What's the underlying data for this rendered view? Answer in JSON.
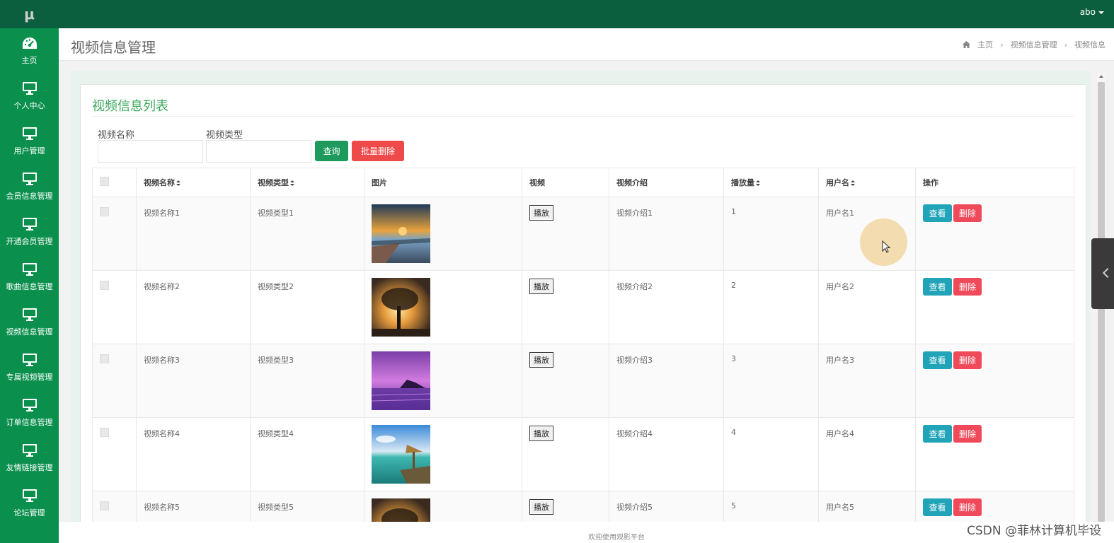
{
  "brand": {
    "logo_text": "μ"
  },
  "topbar": {
    "username": "abo"
  },
  "sidebar": {
    "items": [
      {
        "label": "主页",
        "icon": "dashboard-icon"
      },
      {
        "label": "个人中心",
        "icon": "monitor-icon"
      },
      {
        "label": "用户管理",
        "icon": "monitor-icon"
      },
      {
        "label": "会员信息管理",
        "icon": "monitor-icon"
      },
      {
        "label": "开通会员管理",
        "icon": "monitor-icon"
      },
      {
        "label": "歌曲信息管理",
        "icon": "monitor-icon"
      },
      {
        "label": "视频信息管理",
        "icon": "monitor-icon"
      },
      {
        "label": "专属视频管理",
        "icon": "monitor-icon"
      },
      {
        "label": "订单信息管理",
        "icon": "monitor-icon"
      },
      {
        "label": "友情链接管理",
        "icon": "monitor-icon"
      },
      {
        "label": "论坛管理",
        "icon": "monitor-icon"
      }
    ]
  },
  "header": {
    "page_title": "视频信息管理",
    "breadcrumb": [
      "主页",
      "视频信息管理",
      "视频信息"
    ]
  },
  "card": {
    "title": "视频信息列表",
    "filters": {
      "name_label": "视频名称",
      "name_value": "",
      "type_label": "视频类型",
      "type_value": ""
    },
    "query_button": "查询",
    "batch_delete_button": "批量删除"
  },
  "table": {
    "columns": [
      "视频名称",
      "视频类型",
      "图片",
      "视频",
      "视频介绍",
      "播放量",
      "用户名",
      "操作"
    ],
    "play_label": "播放",
    "view_label": "查看",
    "delete_label": "删除",
    "rows": [
      {
        "name": "视频名称1",
        "type": "视频类型1",
        "intro": "视频介绍1",
        "plays": "1",
        "user": "用户名1",
        "image": "sunset-lake"
      },
      {
        "name": "视频名称2",
        "type": "视频类型2",
        "intro": "视频介绍2",
        "plays": "2",
        "user": "用户名2",
        "image": "tree-sunset"
      },
      {
        "name": "视频名称3",
        "type": "视频类型3",
        "intro": "视频介绍3",
        "plays": "3",
        "user": "用户名3",
        "image": "purple-island"
      },
      {
        "name": "视频名称4",
        "type": "视频类型4",
        "intro": "视频介绍4",
        "plays": "4",
        "user": "用户名4",
        "image": "tropical-beach"
      },
      {
        "name": "视频名称5",
        "type": "视频类型5",
        "intro": "视频介绍5",
        "plays": "5",
        "user": "用户名5",
        "image": "tree-sunset"
      }
    ]
  },
  "footer": {
    "text": "欢迎使用观影平台"
  },
  "watermark": "CSDN @菲林计算机毕设"
}
